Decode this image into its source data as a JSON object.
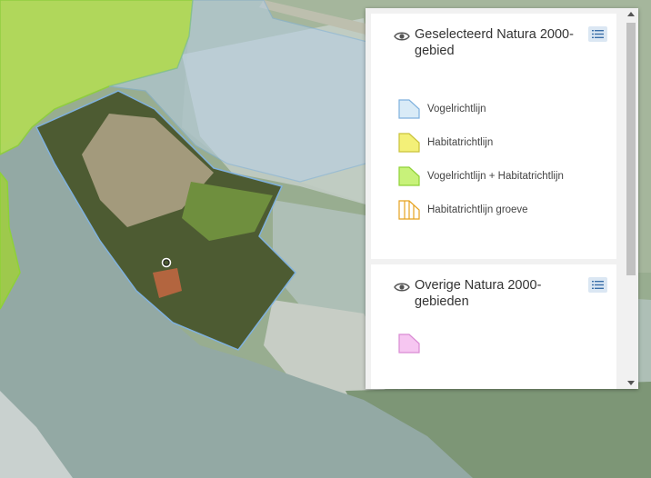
{
  "legend": {
    "sections": [
      {
        "title": "Geselecteerd Natura 2000-gebied",
        "items": [
          {
            "label": "Vogelrichtlijn",
            "fill": "#d9ebf7",
            "stroke": "#7fb1de",
            "pattern": "solid"
          },
          {
            "label": "Habitatrichtlijn",
            "fill": "#f3f078",
            "stroke": "#c9c23a",
            "pattern": "solid"
          },
          {
            "label": "Vogelrichtlijn + Habitatrichtlijn",
            "fill": "#c8f27a",
            "stroke": "#8fd137",
            "pattern": "solid"
          },
          {
            "label": "Habitatrichtlijn groeve",
            "fill": "#ffffff",
            "stroke": "#e6a21f",
            "pattern": "hatch"
          }
        ]
      },
      {
        "title": "Overige Natura 2000-gebieden",
        "items": [
          {
            "label": "",
            "fill": "#f6c6f1",
            "stroke": "#d98bd3",
            "pattern": "solid"
          }
        ]
      }
    ],
    "icons": {
      "toggle": "eye-icon",
      "list": "list-icon"
    }
  },
  "colors": {
    "water": "#93a9a4",
    "selected_area_outline": "#7fb1de",
    "green_natura": "#b9e35a",
    "selected_area_fill": "#b7cfe6"
  }
}
